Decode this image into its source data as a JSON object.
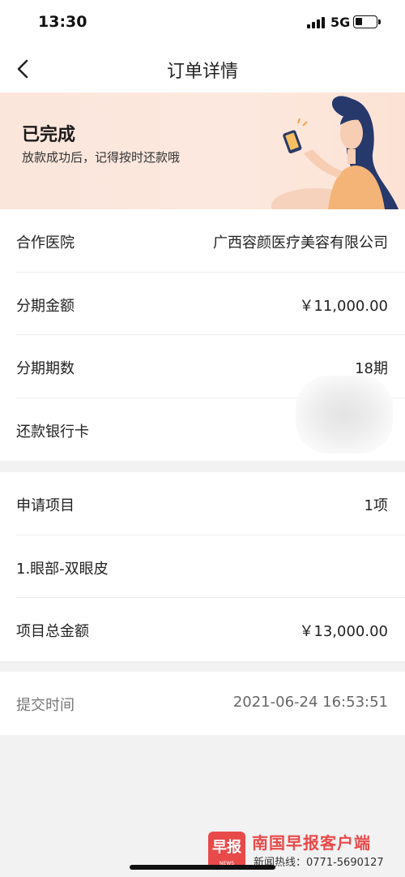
{
  "status_bar": {
    "time": "13:30",
    "network": "5G",
    "battery_level": 0.3
  },
  "nav": {
    "title": "订单详情",
    "back_icon": "chevron-left-icon"
  },
  "banner": {
    "title": "已完成",
    "subtitle": "放款成功后，记得按时还款哦"
  },
  "loan_info": [
    {
      "label": "合作医院",
      "value": "广西容颜医疗美容有限公司"
    },
    {
      "label": "分期金额",
      "value": "￥11,000.00"
    },
    {
      "label": "分期期数",
      "value": "18期"
    },
    {
      "label": "还款银行卡",
      "value": ""
    }
  ],
  "project_info": [
    {
      "label": "申请项目",
      "value": "1项"
    },
    {
      "label": "1.眼部-双眼皮",
      "value": ""
    },
    {
      "label": "项目总金额",
      "value": "￥13,000.00"
    }
  ],
  "submit": {
    "label": "提交时间",
    "value": "2021-06-24 16:53:51"
  },
  "watermark": {
    "badge": "早报",
    "badge_sub": "NEWS",
    "title": "南国早报客户端",
    "hotline": "新闻热线：0771-5690127"
  },
  "colors": {
    "banner_bg": "#fce8de",
    "watermark_red": "#e84a4a"
  }
}
